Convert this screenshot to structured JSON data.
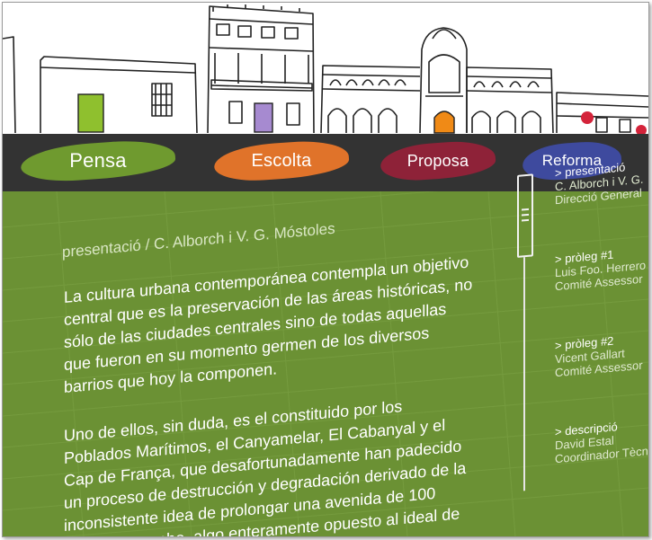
{
  "nav": {
    "items": [
      {
        "label": "Pensa",
        "color": "#6f9a2f"
      },
      {
        "label": "Escolta",
        "color": "#e0732a"
      },
      {
        "label": "Proposa",
        "color": "#8e2238"
      },
      {
        "label": "Reforma",
        "color": "#3e4a9e"
      }
    ]
  },
  "main": {
    "breadcrumb": "presentació / C. Alborch i V. G. Móstoles",
    "paragraph1": [
      "La cultura urbana contemporánea contempla un objetivo",
      "central que es la preservación de las áreas históricas, no",
      "sólo de las ciudades centrales sino de todas aquellas",
      "que fueron en su momento germen de los diversos",
      "barrios que hoy la componen."
    ],
    "paragraph2": [
      "Uno de ellos, sin duda, es el constituido por los",
      "Poblados Marítimos, el Canyamelar, El Cabanyal y el",
      "Cap de França, que desafortunadamente han padecido",
      "un proceso de destrucción y degradación derivado de la",
      "inconsistente idea de prolongar una avenida de 100",
      "metros de ancho, algo enteramente opuesto al ideal de"
    ]
  },
  "sidebar": {
    "sections": [
      {
        "title": "> presentació",
        "lines": [
          "C. Alborch i V. G.",
          "Direcció General"
        ]
      },
      {
        "title": "> pròleg #1",
        "lines": [
          "Luis Foo. Herrero",
          "Comité Assessor"
        ]
      },
      {
        "title": "> pròleg #2",
        "lines": [
          "Vicent Gallart",
          "Comité Assessor"
        ]
      },
      {
        "title": "> descripció",
        "lines": [
          "David Estal",
          "Coordinador Tècn"
        ]
      }
    ]
  },
  "colors": {
    "navbar": "#333333",
    "content_background": "#6b9134",
    "text": "#ffffff"
  }
}
